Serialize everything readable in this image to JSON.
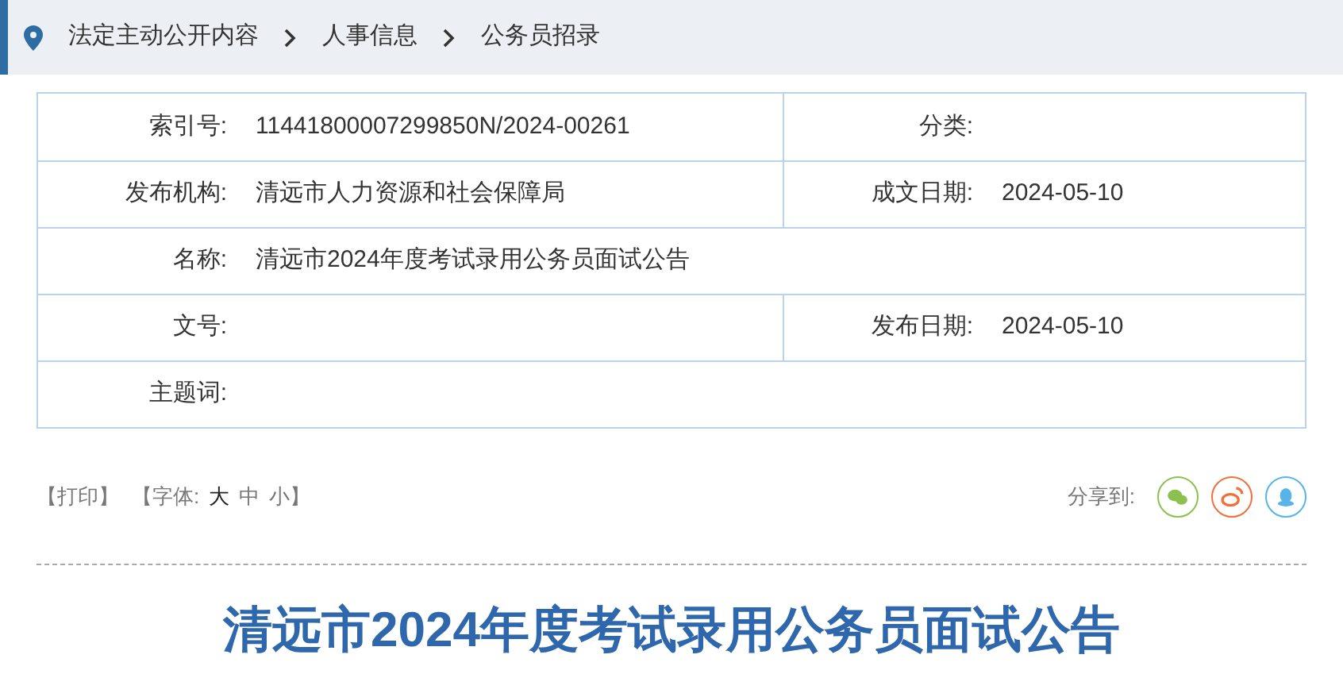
{
  "breadcrumb": [
    "法定主动公开内容",
    "人事信息",
    "公务员招录"
  ],
  "info_rows": [
    {
      "cells": [
        {
          "label": "索引号:",
          "value": "11441800007299850N/2024-00261"
        },
        {
          "label": "分类:"
        }
      ]
    },
    {
      "cells": [
        {
          "label": "发布机构:",
          "value": "清远市人力资源和社会保障局"
        },
        {
          "label": "成文日期:",
          "value": "2024-05-10"
        }
      ]
    },
    {
      "cells": [
        {
          "label": "名称:",
          "value": "清远市2024年度考试录用公务员面试公告"
        }
      ]
    },
    {
      "cells": [
        {
          "label": "文号:"
        },
        {
          "label": "发布日期:",
          "value": "2024-05-10"
        }
      ]
    },
    {
      "cells": [
        {
          "label": "主题词:"
        }
      ]
    }
  ],
  "print_link": "【打印】",
  "font_label": "【字体:",
  "font_sizes": [
    {
      "label": "大",
      "selected": true
    },
    {
      "label": "中",
      "selected": false
    },
    {
      "label": "小",
      "selected": false
    }
  ],
  "font_close": "】",
  "share_label": "分享到:",
  "share_buttons": [
    {
      "kind": "wechat",
      "color": "#8cc152"
    },
    {
      "kind": "weibo",
      "color": "#f0703c"
    },
    {
      "kind": "qq",
      "color": "#58b4e8"
    }
  ],
  "article_title": "清远市2024年度考试录用公务员面试公告"
}
